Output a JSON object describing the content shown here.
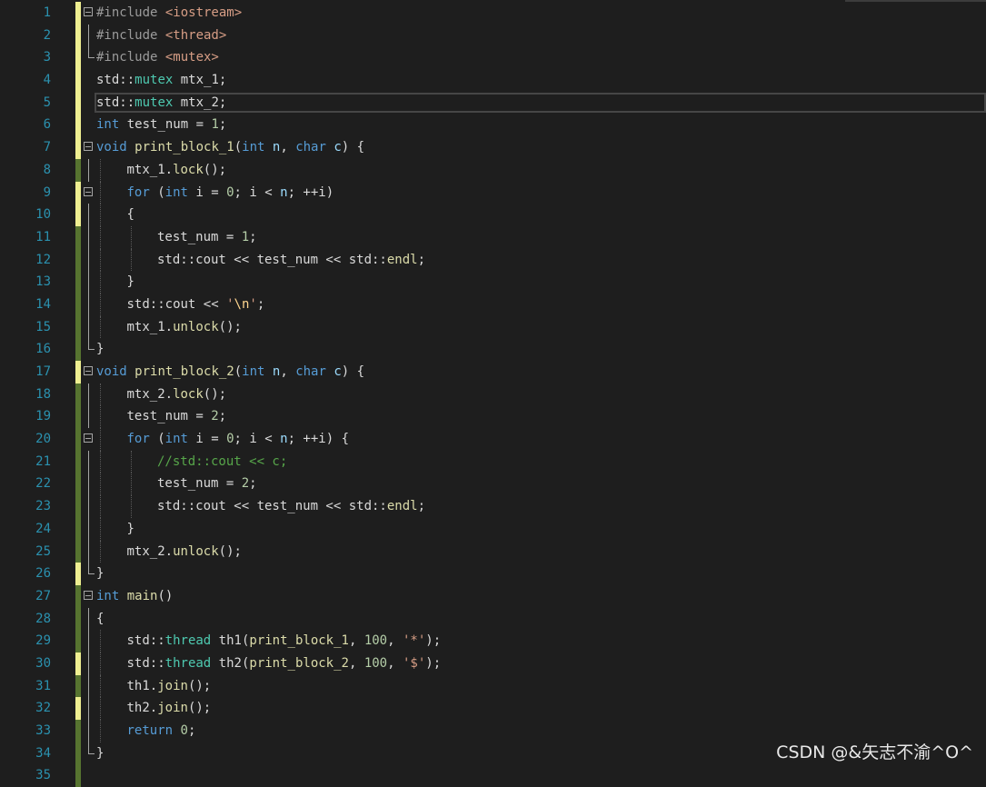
{
  "watermark": "CSDN @&矢志不渝^O^",
  "lines": [
    {
      "n": "1",
      "mark": "yellow",
      "fold": "open",
      "indent": 0,
      "tokens": [
        [
          "pp",
          "#include "
        ],
        [
          "inc",
          "<iostream>"
        ]
      ]
    },
    {
      "n": "2",
      "mark": "yellow",
      "fold": "bar",
      "indent": 0,
      "tokens": [
        [
          "pp",
          "#include "
        ],
        [
          "inc",
          "<thread>"
        ]
      ]
    },
    {
      "n": "3",
      "mark": "yellow",
      "fold": "end",
      "indent": 0,
      "tokens": [
        [
          "pp",
          "#include "
        ],
        [
          "inc",
          "<mutex>"
        ]
      ]
    },
    {
      "n": "4",
      "mark": "yellow",
      "fold": "",
      "indent": 0,
      "tokens": [
        [
          "var",
          "std::"
        ],
        [
          "ty",
          "mutex"
        ],
        [
          "var",
          " mtx_1;"
        ]
      ]
    },
    {
      "n": "5",
      "mark": "yellow",
      "fold": "",
      "indent": 0,
      "current": true,
      "tokens": [
        [
          "var",
          "std::"
        ],
        [
          "ty",
          "mutex"
        ],
        [
          "var",
          " mtx_2;"
        ]
      ]
    },
    {
      "n": "6",
      "mark": "yellow",
      "fold": "",
      "indent": 0,
      "tokens": [
        [
          "kw",
          "int"
        ],
        [
          "var",
          " test_num = "
        ],
        [
          "num",
          "1"
        ],
        [
          "var",
          ";"
        ]
      ]
    },
    {
      "n": "7",
      "mark": "yellow",
      "fold": "open",
      "indent": 0,
      "tokens": [
        [
          "kw",
          "void"
        ],
        [
          "var",
          " "
        ],
        [
          "fn",
          "print_block_1"
        ],
        [
          "var",
          "("
        ],
        [
          "kw",
          "int"
        ],
        [
          "par",
          " n"
        ],
        [
          "var",
          ", "
        ],
        [
          "kw",
          "char"
        ],
        [
          "par",
          " c"
        ],
        [
          "var",
          ") {"
        ]
      ]
    },
    {
      "n": "8",
      "mark": "green",
      "fold": "bar",
      "indent": 1,
      "tokens": [
        [
          "var",
          "mtx_1."
        ],
        [
          "fn",
          "lock"
        ],
        [
          "var",
          "();"
        ]
      ]
    },
    {
      "n": "9",
      "mark": "yellow",
      "fold": "open2",
      "indent": 1,
      "tokens": [
        [
          "kw",
          "for"
        ],
        [
          "var",
          " ("
        ],
        [
          "kw",
          "int"
        ],
        [
          "var",
          " i = "
        ],
        [
          "num",
          "0"
        ],
        [
          "var",
          "; i < "
        ],
        [
          "par",
          "n"
        ],
        [
          "var",
          "; ++i)"
        ]
      ]
    },
    {
      "n": "10",
      "mark": "yellow",
      "fold": "bar",
      "indent": 1,
      "tokens": [
        [
          "var",
          "{"
        ]
      ]
    },
    {
      "n": "11",
      "mark": "green",
      "fold": "bar",
      "indent": 2,
      "tokens": [
        [
          "var",
          "test_num = "
        ],
        [
          "num",
          "1"
        ],
        [
          "var",
          ";"
        ]
      ]
    },
    {
      "n": "12",
      "mark": "green",
      "fold": "bar",
      "indent": 2,
      "tokens": [
        [
          "var",
          "std::cout << test_num << std::"
        ],
        [
          "fn",
          "endl"
        ],
        [
          "var",
          ";"
        ]
      ]
    },
    {
      "n": "13",
      "mark": "green",
      "fold": "bar",
      "indent": 1,
      "tokens": [
        [
          "var",
          "}"
        ]
      ]
    },
    {
      "n": "14",
      "mark": "green",
      "fold": "bar",
      "indent": 1,
      "tokens": [
        [
          "var",
          "std::cout << "
        ],
        [
          "str",
          "'"
        ],
        [
          "esc",
          "\\n"
        ],
        [
          "str",
          "'"
        ],
        [
          "var",
          ";"
        ]
      ]
    },
    {
      "n": "15",
      "mark": "green",
      "fold": "bar",
      "indent": 1,
      "tokens": [
        [
          "var",
          "mtx_1."
        ],
        [
          "fn",
          "unlock"
        ],
        [
          "var",
          "();"
        ]
      ]
    },
    {
      "n": "16",
      "mark": "green",
      "fold": "end",
      "indent": 0,
      "tokens": [
        [
          "var",
          "}"
        ]
      ]
    },
    {
      "n": "17",
      "mark": "yellow",
      "fold": "open",
      "indent": 0,
      "tokens": [
        [
          "kw",
          "void"
        ],
        [
          "var",
          " "
        ],
        [
          "fn",
          "print_block_2"
        ],
        [
          "var",
          "("
        ],
        [
          "kw",
          "int"
        ],
        [
          "par",
          " n"
        ],
        [
          "var",
          ", "
        ],
        [
          "kw",
          "char"
        ],
        [
          "par",
          " c"
        ],
        [
          "var",
          ") {"
        ]
      ]
    },
    {
      "n": "18",
      "mark": "green",
      "fold": "bar",
      "indent": 1,
      "tokens": [
        [
          "var",
          "mtx_2."
        ],
        [
          "fn",
          "lock"
        ],
        [
          "var",
          "();"
        ]
      ]
    },
    {
      "n": "19",
      "mark": "green",
      "fold": "bar",
      "indent": 1,
      "tokens": [
        [
          "var",
          "test_num = "
        ],
        [
          "num",
          "2"
        ],
        [
          "var",
          ";"
        ]
      ]
    },
    {
      "n": "20",
      "mark": "green",
      "fold": "open2",
      "indent": 1,
      "tokens": [
        [
          "kw",
          "for"
        ],
        [
          "var",
          " ("
        ],
        [
          "kw",
          "int"
        ],
        [
          "var",
          " i = "
        ],
        [
          "num",
          "0"
        ],
        [
          "var",
          "; i < "
        ],
        [
          "par",
          "n"
        ],
        [
          "var",
          "; ++i) {"
        ]
      ]
    },
    {
      "n": "21",
      "mark": "green",
      "fold": "bar",
      "indent": 2,
      "tokens": [
        [
          "cm",
          "//std::cout << c;"
        ]
      ]
    },
    {
      "n": "22",
      "mark": "green",
      "fold": "bar",
      "indent": 2,
      "tokens": [
        [
          "var",
          "test_num = "
        ],
        [
          "num",
          "2"
        ],
        [
          "var",
          ";"
        ]
      ]
    },
    {
      "n": "23",
      "mark": "green",
      "fold": "bar",
      "indent": 2,
      "tokens": [
        [
          "var",
          "std::cout << test_num << std::"
        ],
        [
          "fn",
          "endl"
        ],
        [
          "var",
          ";"
        ]
      ]
    },
    {
      "n": "24",
      "mark": "green",
      "fold": "bar",
      "indent": 1,
      "tokens": [
        [
          "var",
          "}"
        ]
      ]
    },
    {
      "n": "25",
      "mark": "green",
      "fold": "bar",
      "indent": 1,
      "tokens": [
        [
          "var",
          "mtx_2."
        ],
        [
          "fn",
          "unlock"
        ],
        [
          "var",
          "();"
        ]
      ]
    },
    {
      "n": "26",
      "mark": "yellow",
      "fold": "end",
      "indent": 0,
      "tokens": [
        [
          "var",
          "}"
        ]
      ]
    },
    {
      "n": "27",
      "mark": "green",
      "fold": "open",
      "indent": 0,
      "tokens": [
        [
          "kw",
          "int"
        ],
        [
          "var",
          " "
        ],
        [
          "fn",
          "main"
        ],
        [
          "var",
          "()"
        ]
      ]
    },
    {
      "n": "28",
      "mark": "green",
      "fold": "bar",
      "indent": 0,
      "tokens": [
        [
          "var",
          "{"
        ]
      ]
    },
    {
      "n": "29",
      "mark": "green",
      "fold": "bar",
      "indent": 1,
      "tokens": [
        [
          "var",
          "std::"
        ],
        [
          "ty",
          "thread"
        ],
        [
          "var",
          " th1("
        ],
        [
          "fn",
          "print_block_1"
        ],
        [
          "var",
          ", "
        ],
        [
          "num",
          "100"
        ],
        [
          "var",
          ", "
        ],
        [
          "str",
          "'*'"
        ],
        [
          "var",
          ");"
        ]
      ]
    },
    {
      "n": "30",
      "mark": "yellow",
      "fold": "bar",
      "indent": 1,
      "tokens": [
        [
          "var",
          "std::"
        ],
        [
          "ty",
          "thread"
        ],
        [
          "var",
          " th2("
        ],
        [
          "fn",
          "print_block_2"
        ],
        [
          "var",
          ", "
        ],
        [
          "num",
          "100"
        ],
        [
          "var",
          ", "
        ],
        [
          "str",
          "'$'"
        ],
        [
          "var",
          ");"
        ]
      ]
    },
    {
      "n": "31",
      "mark": "green",
      "fold": "bar",
      "indent": 1,
      "tokens": [
        [
          "var",
          "th1."
        ],
        [
          "fn",
          "join"
        ],
        [
          "var",
          "();"
        ]
      ]
    },
    {
      "n": "32",
      "mark": "yellow",
      "fold": "bar",
      "indent": 1,
      "tokens": [
        [
          "var",
          "th2."
        ],
        [
          "fn",
          "join"
        ],
        [
          "var",
          "();"
        ]
      ]
    },
    {
      "n": "33",
      "mark": "green",
      "fold": "bar",
      "indent": 1,
      "tokens": [
        [
          "kw",
          "return"
        ],
        [
          "var",
          " "
        ],
        [
          "num",
          "0"
        ],
        [
          "var",
          ";"
        ]
      ]
    },
    {
      "n": "34",
      "mark": "green",
      "fold": "end",
      "indent": 0,
      "tokens": [
        [
          "var",
          "}"
        ]
      ]
    },
    {
      "n": "35",
      "mark": "green",
      "fold": "",
      "indent": 0,
      "tokens": []
    }
  ]
}
